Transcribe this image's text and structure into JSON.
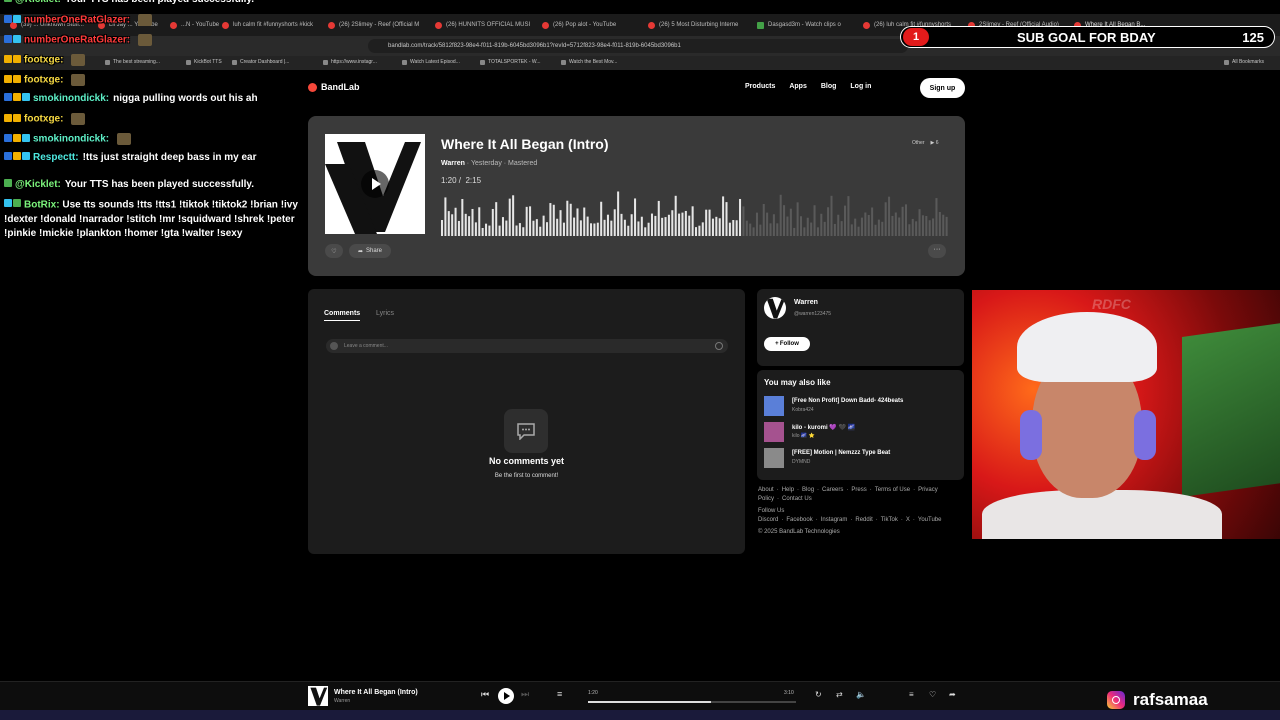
{
  "browser": {
    "tabs": [
      {
        "label": "(39) ... Unknown Stuff...",
        "color": "red"
      },
      {
        "label": "Lil Jay ... YouTube",
        "color": "red"
      },
      {
        "label": "...N - YouTube",
        "color": "red"
      },
      {
        "label": "luh calm fit #funnyshorts #kick",
        "color": "red"
      },
      {
        "label": "(26) 2Slimey - Reef (Official M",
        "color": "red"
      },
      {
        "label": "(26) HUNNITS OFFICIAL MUSI",
        "color": "red"
      },
      {
        "label": "(26) Pop alot - YouTube",
        "color": "red"
      },
      {
        "label": "(26) 5 Most Disturbing Interne",
        "color": "red"
      },
      {
        "label": "Dasgasd3m - Watch clips o",
        "color": "green"
      },
      {
        "label": "(26) luh calm fit #funnyshorts",
        "color": "red"
      },
      {
        "label": "2Slimey - Reef (Official Audio)",
        "color": "red"
      },
      {
        "label": "Where It All Began B...",
        "color": "red"
      }
    ],
    "url": "bandlab.com/track/5812f823-98e4-f011-819b-6045bd3096b1?revId=5712f823-98e4-f011-819b-6045bd3096b1",
    "bookmarks": [
      "The best streaming...",
      "KickBot TTS",
      "Creator Dashboard |...",
      "https://www.instagr...",
      "Watch Latest Episod...",
      "TOTALSPORTEK - W...",
      "Watch the Best Mov..."
    ],
    "all_bookmarks": "All Bookmarks"
  },
  "site": {
    "logo": "BandLab",
    "nav": [
      "Products",
      "Apps",
      "Blog",
      "Log in"
    ],
    "signup": "Sign up"
  },
  "track": {
    "title": "Where It All Began (Intro)",
    "artist": "Warren",
    "meta": " · Yesterday · Mastered",
    "current_time": "1:20",
    "duration": "2:15",
    "genre": "Other",
    "plays": "6",
    "like_label": "",
    "share_label": "Share",
    "more_label": "···",
    "progress": 0.593
  },
  "comments": {
    "tabs": [
      "Comments",
      "Lyrics"
    ],
    "placeholder": "Leave a comment...",
    "empty_title": "No comments yet",
    "empty_sub": "Be the first to comment!"
  },
  "artist": {
    "name": "Warren",
    "handle": "@warren123475",
    "follow": "Follow"
  },
  "also_like": {
    "title": "You may also like",
    "items": [
      {
        "title": "[Free Non Profit] Down Badd- 424beats",
        "artist": "Kobra424",
        "color": "#5a7fd8"
      },
      {
        "title": "kilo - kuromi 💜 🖤 🌌",
        "artist": "kilo 🌌 ⭐",
        "color": "#a5528f"
      },
      {
        "title": "[FREE] Motion | Nemzzz Type Beat",
        "artist": "DYMND",
        "color": "#8a8a8a"
      }
    ]
  },
  "footer": {
    "links": [
      "About",
      "Help",
      "Blog",
      "Careers",
      "Press",
      "Terms of Use",
      "Privacy Policy",
      "Contact Us"
    ],
    "follow_us": "Follow Us",
    "socials": [
      "Discord",
      "Facebook",
      "Instagram",
      "Reddit",
      "TikTok",
      "X",
      "YouTube"
    ],
    "copyright": "© 2025 BandLab Technologies"
  },
  "player": {
    "title": "Where It All Began (Intro)",
    "artist": "Warren",
    "elapsed": "1:20",
    "total": "3:10",
    "progress": 0.59
  },
  "stream": {
    "chat": [
      {
        "name": "@Kicklet:",
        "name_color": "green",
        "message": "Your TTS has been played successfully."
      },
      {
        "name": "numberOneRatGlazer:",
        "name_color": "red",
        "message": ""
      },
      {
        "name": "numberOneRatGlazer:",
        "name_color": "red",
        "message": ""
      },
      {
        "name": "footxge:",
        "name_color": "yellow",
        "message": ""
      },
      {
        "name": "footxge:",
        "name_color": "yellow",
        "message": ""
      },
      {
        "name": "smokinondickk:",
        "name_color": "cyan",
        "message": "nigga pulling words out his ah"
      },
      {
        "name": "footxge:",
        "name_color": "yellow",
        "message": ""
      },
      {
        "name": "smokinondickk:",
        "name_color": "cyan",
        "message": ""
      },
      {
        "name": "Respectt:",
        "name_color": "teal",
        "message": "!tts just straight deep bass in my ear"
      },
      {
        "name": "@Kicklet:",
        "name_color": "green",
        "message": "Your TTS has been played successfully."
      }
    ],
    "bot_name": "BotRix:",
    "bot_message": "Use tts sounds !tts !tts1 !tiktok !tiktok2 !brian !ivy !dexter !donald !narrador !stitch !mr !squidward !shrek !peter !pinkie !mickie !plankton !homer !gta !walter !sexy",
    "sub_goal_count": "1",
    "sub_goal_label": "SUB GOAL FOR BDAY",
    "sub_goal_target": "125",
    "cam_sign": "RDFC",
    "instagram": "rafsamaa"
  }
}
